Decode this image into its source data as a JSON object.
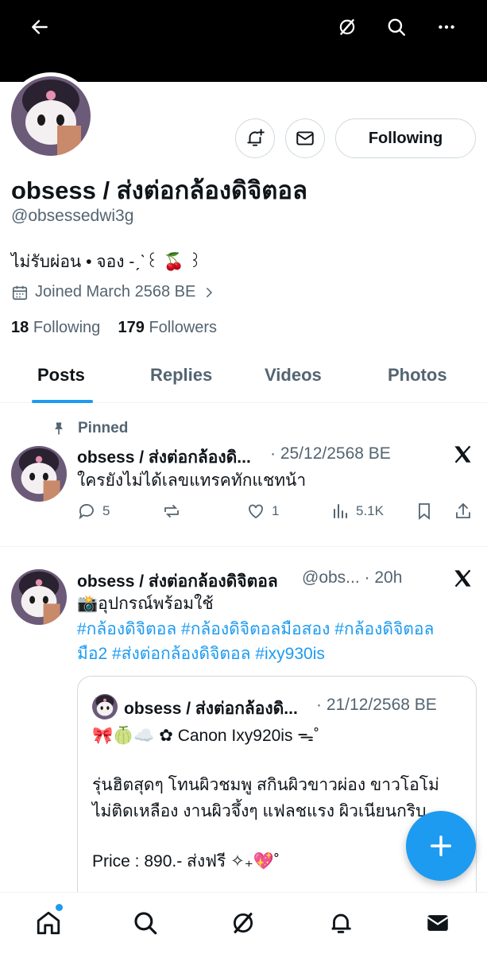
{
  "profile": {
    "display_name": "obsess / ส่งต่อกล้องดิจิตอล",
    "handle": "@obsessedwi3g",
    "bio": "ไม่รับผ่อน • จอง -ˏˋ꒰ 🍒 ꒱",
    "joined": "Joined March 2568 BE",
    "following_count": "18",
    "following_label": "Following",
    "followers_count": "179",
    "followers_label": "Followers",
    "follow_button": "Following"
  },
  "tabs": [
    {
      "label": "Posts",
      "active": true
    },
    {
      "label": "Replies",
      "active": false
    },
    {
      "label": "Videos",
      "active": false
    },
    {
      "label": "Photos",
      "active": false
    }
  ],
  "pinned_tweet": {
    "pinned_label": "Pinned",
    "name": "obsess / ส่งต่อกล้องดิ...",
    "meta": "· 25/12/2568 BE",
    "text": "ใครยังไม่ได้เลขแทรคทักแชทน้า",
    "replies": "5",
    "likes": "1",
    "views": "5.1K"
  },
  "tweet": {
    "name": "obsess / ส่งต่อกล้องดิจิตอล",
    "meta": "@obs... · 20h",
    "line1": "📸อุปกรณ์พร้อมใช้",
    "hashtags_line1": "#กล้องดิจิตอล #กล้องดิจิตอลมือสอง #กล้องดิจิตอล",
    "hashtags_line2": "มือ2 #ส่งต่อกล้องดิจิตอล #ixy930is"
  },
  "quote": {
    "name": "obsess / ส่งต่อกล้องดิ...",
    "meta": "· 21/12/2568 BE",
    "line1": "🎀🍈☁️ ✿ Canon Ixy920is ᯓ˚",
    "line2": "รุ่นฮิตสุดๆ โทนผิวชมพู สกินผิวขาวผ่อง ขาวโอโม่",
    "line3": "ไม่ติดเหลือง งานผิวจึ้งๆ แฟลชแรง ผิวเนียนกริบ",
    "line4": "Price : 890.- ส่งฟรี ✧₊💖˚"
  },
  "colors": {
    "accent": "#1d9bf0",
    "text": "#0f1419",
    "muted": "#536471",
    "banner": "#000000"
  },
  "icons": [
    "back-arrow-icon",
    "grok-icon",
    "search-icon",
    "more-icon",
    "bell-plus-icon",
    "mail-icon",
    "calendar-icon",
    "chevron-right-icon",
    "pin-icon",
    "x-logo-icon",
    "reply-icon",
    "retweet-icon",
    "like-icon",
    "views-icon",
    "bookmark-icon",
    "share-icon",
    "compose-plus-icon",
    "home-icon",
    "notifications-icon",
    "messages-icon"
  ]
}
